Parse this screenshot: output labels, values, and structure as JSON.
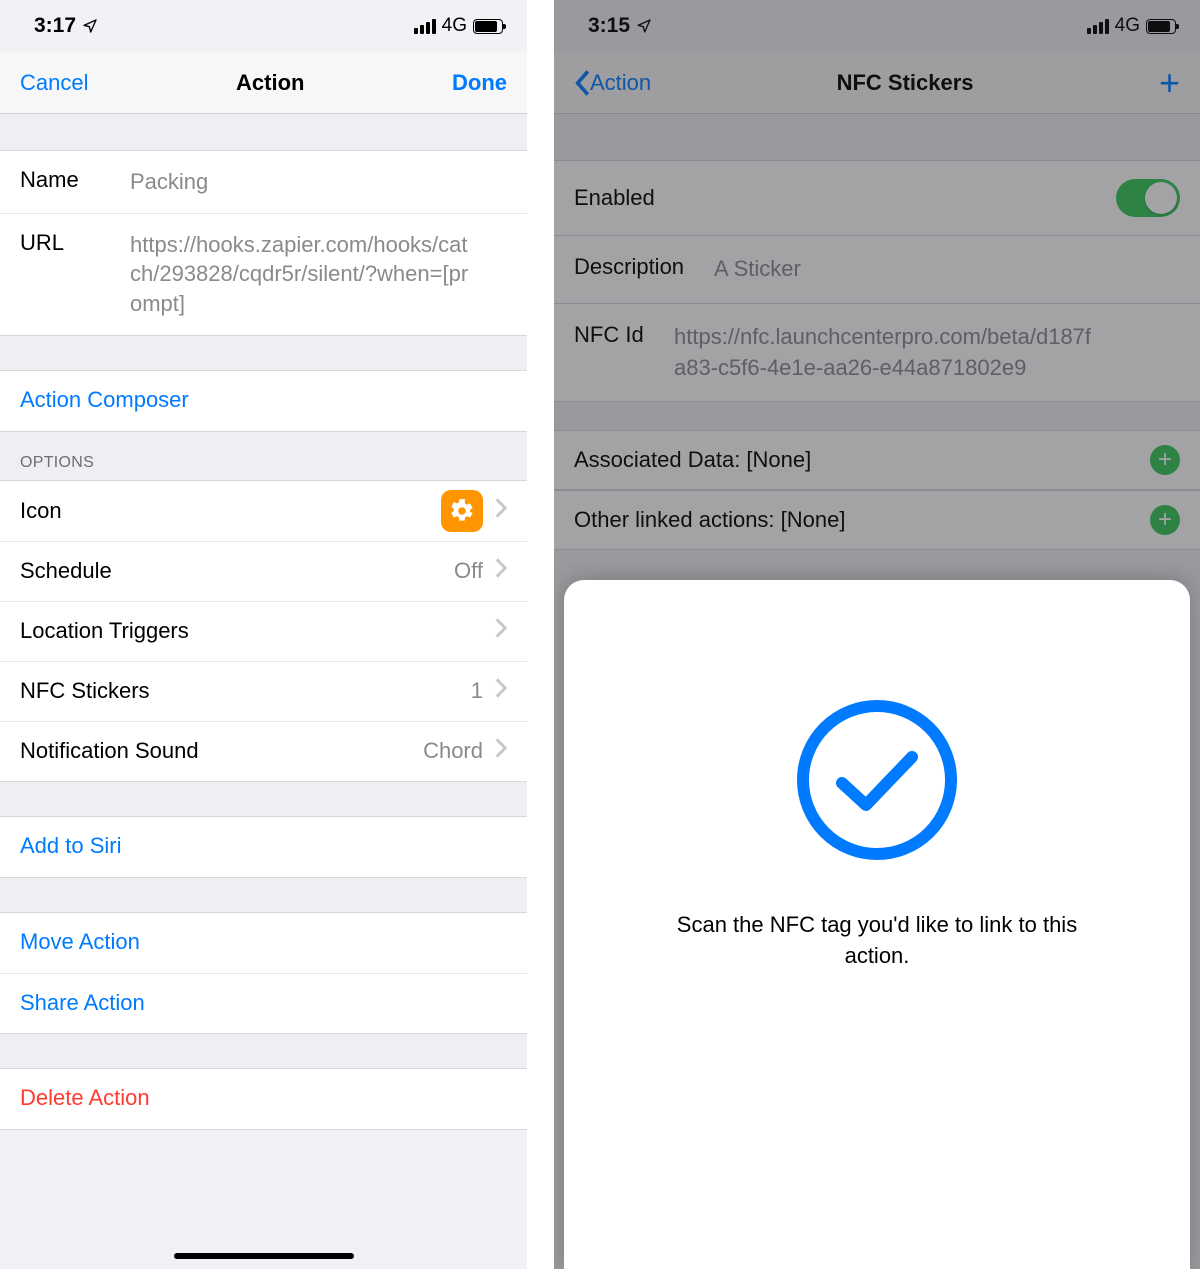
{
  "left": {
    "status": {
      "time": "3:17",
      "network": "4G"
    },
    "nav": {
      "cancel": "Cancel",
      "title": "Action",
      "done": "Done"
    },
    "name_label": "Name",
    "name_value": "Packing",
    "url_label": "URL",
    "url_value": "https://hooks.zapier.com/hooks/catch/293828/cqdr5r/silent/?when=[prompt]",
    "composer": "Action Composer",
    "options_header": "OPTIONS",
    "rows": {
      "icon": "Icon",
      "schedule": "Schedule",
      "schedule_val": "Off",
      "location": "Location Triggers",
      "nfc": "NFC Stickers",
      "nfc_val": "1",
      "sound": "Notification Sound",
      "sound_val": "Chord"
    },
    "siri": "Add to Siri",
    "move": "Move Action",
    "share": "Share Action",
    "delete": "Delete Action"
  },
  "right": {
    "status": {
      "time": "3:15",
      "network": "4G"
    },
    "nav": {
      "back": "Action",
      "title": "NFC Stickers"
    },
    "enabled": "Enabled",
    "desc_label": "Description",
    "desc_value": "A Sticker",
    "nfcid_label": "NFC Id",
    "nfcid_value": "https://nfc.launchcenterpro.com/beta/d187fa83-c5f6-4e1e-aa26-e44a871802e9",
    "assoc": "Associated Data: [None]",
    "other": "Other linked actions: [None]",
    "sheet_text": "Scan the NFC tag you'd like to link to this action."
  }
}
